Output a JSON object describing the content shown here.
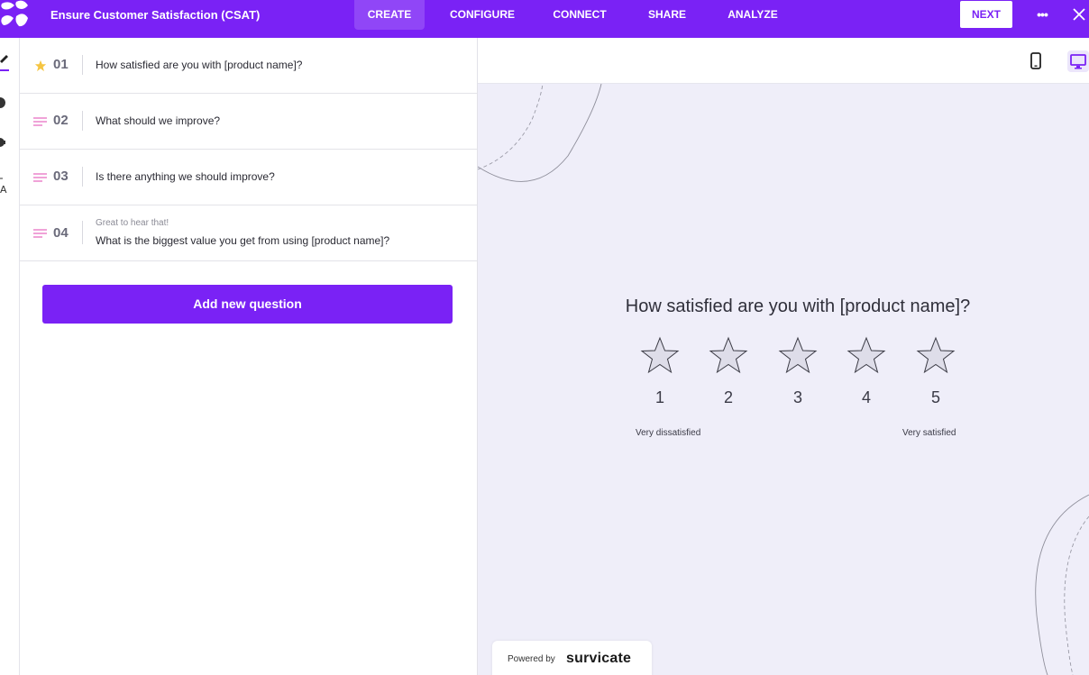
{
  "app": {
    "survey_title": "Ensure Customer Satisfaction (CSAT)",
    "brand_color": "#7a22f5"
  },
  "nav": {
    "tabs": [
      {
        "label": "CREATE",
        "active": true
      },
      {
        "label": "CONFIGURE",
        "active": false
      },
      {
        "label": "CONNECT",
        "active": false
      },
      {
        "label": "SHARE",
        "active": false
      },
      {
        "label": "ANALYZE",
        "active": false
      }
    ],
    "next_label": "NEXT",
    "more_icon": "ellipsis-icon",
    "close_icon": "close-icon"
  },
  "rail": {
    "items": [
      {
        "icon": "pencil-icon",
        "active": true
      },
      {
        "icon": "palette-icon",
        "active": false
      },
      {
        "icon": "gear-icon",
        "active": false
      },
      {
        "icon": "translate-icon",
        "active": false
      }
    ]
  },
  "questions": [
    {
      "number": "01",
      "type_icon": "star-icon",
      "intro": "",
      "text": "How satisfied are you with [product name]?"
    },
    {
      "number": "02",
      "type_icon": "text-lines-icon",
      "intro": "",
      "text": "What should we improve?"
    },
    {
      "number": "03",
      "type_icon": "text-lines-icon",
      "intro": "",
      "text": "Is there anything we should improve?"
    },
    {
      "number": "04",
      "type_icon": "text-lines-icon",
      "intro": "Great to hear that!",
      "text": "What is the biggest value you get from using [product name]?"
    }
  ],
  "add_question_label": "Add new question",
  "preview": {
    "device_buttons": [
      {
        "icon": "phone-icon",
        "active": false
      },
      {
        "icon": "desktop-icon",
        "active": true
      }
    ],
    "question": "How satisfied are you with [product name]?",
    "scale": [
      "1",
      "2",
      "3",
      "4",
      "5"
    ],
    "min_label": "Very dissatisfied",
    "max_label": "Very satisfied",
    "powered_by": "Powered by",
    "brand": "survicate"
  }
}
